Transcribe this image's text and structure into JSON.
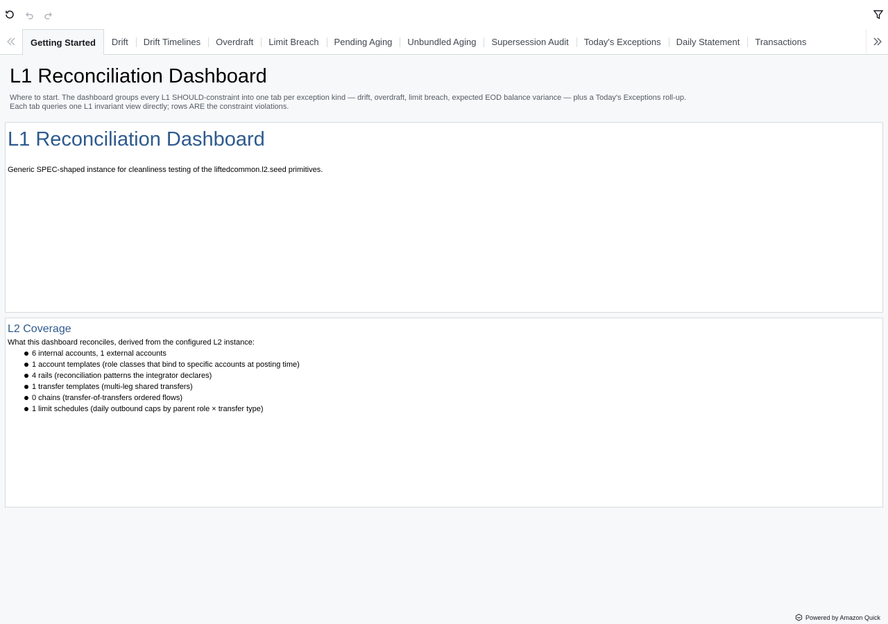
{
  "toolbar": {
    "reset_icon": "reset-icon",
    "undo_icon": "undo-icon",
    "redo_icon": "redo-icon",
    "filter_icon": "filter-icon"
  },
  "tabs": [
    {
      "label": "Getting Started",
      "active": true
    },
    {
      "label": "Drift"
    },
    {
      "label": "Drift Timelines"
    },
    {
      "label": "Overdraft"
    },
    {
      "label": "Limit Breach"
    },
    {
      "label": "Pending Aging"
    },
    {
      "label": "Unbundled Aging"
    },
    {
      "label": "Supersession Audit"
    },
    {
      "label": "Today's Exceptions"
    },
    {
      "label": "Daily Statement"
    },
    {
      "label": "Transactions"
    }
  ],
  "sheet": {
    "title": "L1 Reconciliation Dashboard",
    "description": "Where to start. The dashboard groups every L1 SHOULD-constraint into one tab per exception kind — drift, overdraft, limit breach, expected EOD balance variance — plus a Today's Exceptions roll-up. Each tab queries one L1 invariant view directly; rows ARE the constraint violations."
  },
  "intro_panel": {
    "title": "L1 Reconciliation Dashboard",
    "body": "Generic SPEC-shaped instance for cleanliness testing of the liftedcommon.l2.seed primitives."
  },
  "coverage_panel": {
    "title": "L2 Coverage",
    "intro": "What this dashboard reconciles, derived from the configured L2 instance:",
    "items": [
      "6 internal accounts, 1 external accounts",
      "1 account templates (role classes that bind to specific accounts at posting time)",
      "4 rails (reconciliation patterns the integrator declares)",
      "1 transfer templates (multi-leg shared transfers)",
      "0 chains (transfer-of-transfers ordered flows)",
      "1 limit schedules (daily outbound caps by parent role × transfer type)"
    ]
  },
  "footer": {
    "powered_by": "Powered by Amazon Quick"
  },
  "colors": {
    "accent_title": "#2e5a8e",
    "background": "#f7f8fa",
    "panel_border": "#d5dbdb"
  }
}
